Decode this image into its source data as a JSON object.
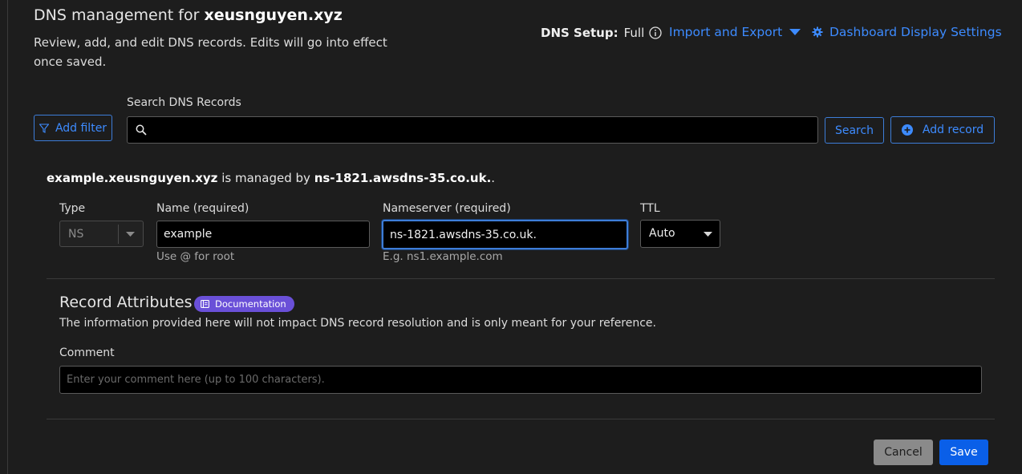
{
  "header": {
    "title_prefix": "DNS management for",
    "title_domain": "xeusnguyen.xyz",
    "subtitle": "Review, add, and edit DNS records. Edits will go into effect once saved.",
    "dns_setup_label": "DNS Setup:",
    "dns_setup_value": "Full",
    "import_export_label": "Import and Export",
    "dashboard_settings_label": "Dashboard Display Settings"
  },
  "toolbar": {
    "add_filter_label": "Add filter",
    "search_label": "Search DNS Records",
    "search_value": "",
    "search_button_label": "Search",
    "add_record_label": "Add record"
  },
  "record": {
    "managed_name": "example.xeusnguyen.xyz",
    "managed_text": "is managed by",
    "managed_ns": "ns-1821.awsdns-35.co.uk.",
    "managed_suffix": ".",
    "type_label": "Type",
    "type_value": "NS",
    "name_label": "Name (required)",
    "name_value": "example",
    "name_hint": "Use @ for root",
    "nameserver_label": "Nameserver (required)",
    "nameserver_value": "ns-1821.awsdns-35.co.uk.",
    "nameserver_hint": "E.g. ns1.example.com",
    "ttl_label": "TTL",
    "ttl_value": "Auto"
  },
  "attributes": {
    "title": "Record Attributes",
    "doc_badge": "Documentation",
    "description": "The information provided here will not impact DNS record resolution and is only meant for your reference.",
    "comment_label": "Comment",
    "comment_placeholder": "Enter your comment here (up to 100 characters).",
    "comment_value": ""
  },
  "actions": {
    "cancel_label": "Cancel",
    "save_label": "Save"
  },
  "colors": {
    "accent": "#3d8bff",
    "badge": "#6a50d8",
    "save": "#0a5fe8"
  }
}
